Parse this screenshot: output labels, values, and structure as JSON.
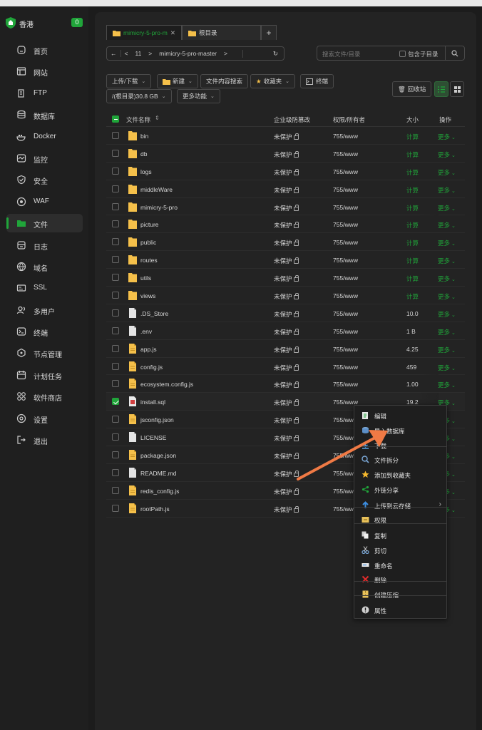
{
  "colors": {
    "accent": "#20a53a",
    "arrow": "#f07a45",
    "folder": "#f5c04a"
  },
  "sidebar": {
    "brand": "香港",
    "badge": "0",
    "items": [
      {
        "label": "首页",
        "icon": "home-icon"
      },
      {
        "label": "网站",
        "icon": "website-icon"
      },
      {
        "label": "FTP",
        "icon": "ftp-icon"
      },
      {
        "label": "数据库",
        "icon": "database-icon"
      },
      {
        "label": "Docker",
        "icon": "docker-icon"
      },
      {
        "label": "监控",
        "icon": "monitor-icon"
      },
      {
        "label": "安全",
        "icon": "security-icon"
      },
      {
        "label": "WAF",
        "icon": "waf-icon"
      },
      {
        "label": "文件",
        "icon": "folder-icon",
        "active": true
      },
      {
        "label": "日志",
        "icon": "log-icon"
      },
      {
        "label": "域名",
        "icon": "globe-icon"
      },
      {
        "label": "SSL",
        "icon": "ssl-icon"
      },
      {
        "label": "多用户",
        "icon": "users-icon"
      },
      {
        "label": "终端",
        "icon": "terminal-icon"
      },
      {
        "label": "节点管理",
        "icon": "nodes-icon"
      },
      {
        "label": "计划任务",
        "icon": "calendar-icon"
      },
      {
        "label": "软件商店",
        "icon": "store-icon"
      },
      {
        "label": "设置",
        "icon": "settings-icon"
      },
      {
        "label": "退出",
        "icon": "logout-icon"
      }
    ]
  },
  "tabs": [
    {
      "label": "mimicry-5-pro-m",
      "active": true
    },
    {
      "label": "根目录",
      "active": false
    }
  ],
  "tab_add": "+",
  "pathbar": {
    "back": "←",
    "prev": "<",
    "level": "11",
    "sep": ">",
    "folder": "mimicry-5-pro-master",
    "sep2": ">",
    "refresh": "↻"
  },
  "search": {
    "placeholder": "搜索文件/目录",
    "subdir_label": "包含子目录"
  },
  "toolbar": {
    "upload": "上传/下载",
    "new": "新建",
    "content_search": "文件内容搜索",
    "favorites": "收藏夹",
    "terminal": "终端",
    "recycle": "回收站",
    "disk": "/(根目录)30.8 GB",
    "more": "更多功能"
  },
  "table": {
    "headers": {
      "name": "文件名称",
      "protect": "企业级防篡改",
      "perm": "权限/所有者",
      "size": "大小",
      "op": "操作"
    },
    "rows": [
      {
        "name": "bin",
        "type": "folder",
        "protect": "未保护",
        "perm": "755/www",
        "size": "计算",
        "op": "更多"
      },
      {
        "name": "db",
        "type": "folder",
        "protect": "未保护",
        "perm": "755/www",
        "size": "计算",
        "op": "更多"
      },
      {
        "name": "logs",
        "type": "folder",
        "protect": "未保护",
        "perm": "755/www",
        "size": "计算",
        "op": "更多"
      },
      {
        "name": "middleWare",
        "type": "folder",
        "protect": "未保护",
        "perm": "755/www",
        "size": "计算",
        "op": "更多"
      },
      {
        "name": "mimicry-5-pro",
        "type": "folder",
        "protect": "未保护",
        "perm": "755/www",
        "size": "计算",
        "op": "更多"
      },
      {
        "name": "picture",
        "type": "folder",
        "protect": "未保护",
        "perm": "755/www",
        "size": "计算",
        "op": "更多"
      },
      {
        "name": "public",
        "type": "folder",
        "protect": "未保护",
        "perm": "755/www",
        "size": "计算",
        "op": "更多"
      },
      {
        "name": "routes",
        "type": "folder",
        "protect": "未保护",
        "perm": "755/www",
        "size": "计算",
        "op": "更多"
      },
      {
        "name": "utils",
        "type": "folder",
        "protect": "未保护",
        "perm": "755/www",
        "size": "计算",
        "op": "更多"
      },
      {
        "name": "views",
        "type": "folder",
        "protect": "未保护",
        "perm": "755/www",
        "size": "计算",
        "op": "更多"
      },
      {
        "name": ".DS_Store",
        "type": "file",
        "protect": "未保护",
        "perm": "755/www",
        "size": "10.0",
        "op": "更多"
      },
      {
        "name": ".env",
        "type": "file",
        "protect": "未保护",
        "perm": "755/www",
        "size": "1 B",
        "op": "更多"
      },
      {
        "name": "app.js",
        "type": "js",
        "protect": "未保护",
        "perm": "755/www",
        "size": "4.25",
        "op": "更多"
      },
      {
        "name": "config.js",
        "type": "js",
        "protect": "未保护",
        "perm": "755/www",
        "size": "459",
        "op": "更多"
      },
      {
        "name": "ecosystem.config.js",
        "type": "js",
        "protect": "未保护",
        "perm": "755/www",
        "size": "1.00",
        "op": "更多"
      },
      {
        "name": "install.sql",
        "type": "sql",
        "protect": "未保护",
        "perm": "755/www",
        "size": "19.2",
        "op": "更多",
        "selected": true
      },
      {
        "name": "jsconfig.json",
        "type": "js",
        "protect": "未保护",
        "perm": "755/www",
        "size": "",
        "op": "更多"
      },
      {
        "name": "LICENSE",
        "type": "file",
        "protect": "未保护",
        "perm": "755/www",
        "size": "",
        "op": "更多"
      },
      {
        "name": "package.json",
        "type": "js",
        "protect": "未保护",
        "perm": "755/www",
        "size": "",
        "op": "更多"
      },
      {
        "name": "README.md",
        "type": "file",
        "protect": "未保护",
        "perm": "755/www",
        "size": "",
        "op": "更多"
      },
      {
        "name": "redis_config.js",
        "type": "js",
        "protect": "未保护",
        "perm": "755/www",
        "size": "",
        "op": "更多"
      },
      {
        "name": "rootPath.js",
        "type": "js",
        "protect": "未保护",
        "perm": "755/www",
        "size": "",
        "op": "更多"
      }
    ]
  },
  "context_menu": [
    {
      "label": "编辑",
      "icon": "edit-icon"
    },
    {
      "label": "导入数据库",
      "icon": "import-db-icon"
    },
    {
      "label": "下载",
      "icon": "download-icon"
    },
    {
      "label": "文件拆分",
      "icon": "split-icon"
    },
    {
      "label": "添加到收藏夹",
      "icon": "star-icon"
    },
    {
      "label": "外链分享",
      "icon": "share-icon"
    },
    {
      "label": "上传到云存储",
      "icon": "cloud-upload-icon",
      "submenu": "›"
    },
    {
      "label": "权限",
      "icon": "permission-icon"
    },
    {
      "label": "复制",
      "icon": "copy-icon"
    },
    {
      "label": "剪切",
      "icon": "cut-icon"
    },
    {
      "label": "重命名",
      "icon": "rename-icon"
    },
    {
      "label": "删除",
      "icon": "delete-icon"
    },
    {
      "label": "创建压缩",
      "icon": "archive-icon"
    },
    {
      "label": "属性",
      "icon": "info-icon"
    }
  ]
}
